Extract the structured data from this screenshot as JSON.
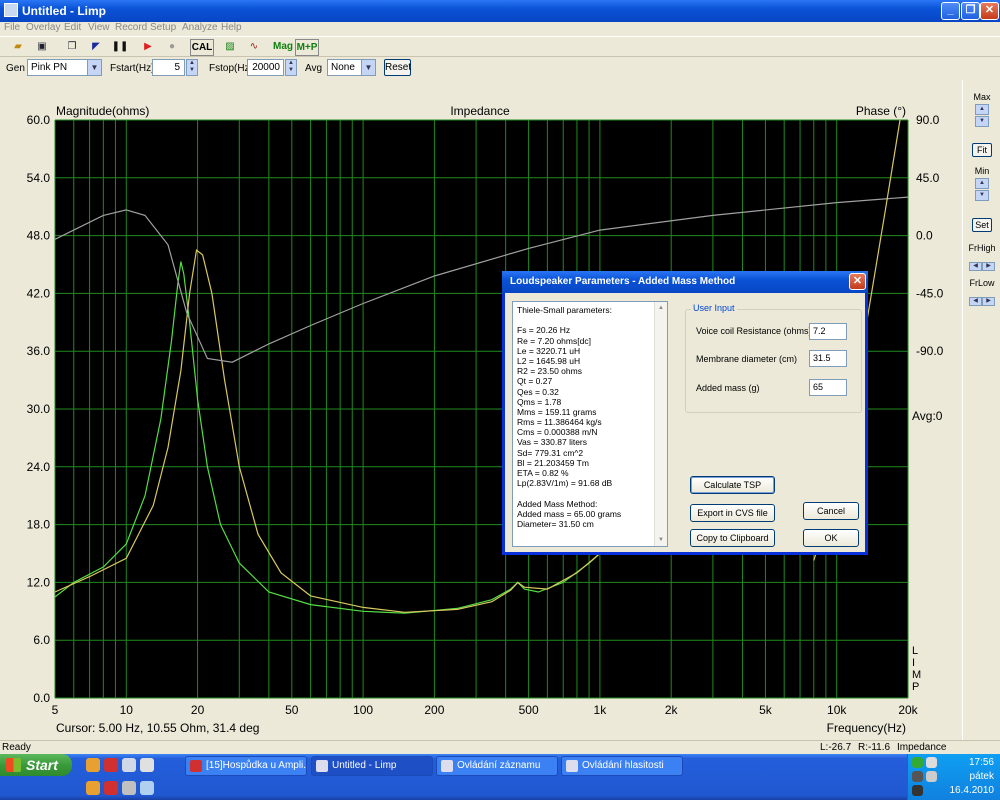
{
  "window": {
    "title": "Untitled - Limp"
  },
  "menu": [
    "File",
    "Overlay",
    "Edit",
    "View",
    "Record",
    "Setup",
    "Analyze",
    "Help"
  ],
  "toolbar": {
    "cal": "CAL",
    "mag": "Mag",
    "mp": "M+P"
  },
  "gen": {
    "gen_label": "Gen",
    "gen_value": "Pink PN",
    "fstart_label": "Fstart(Hz)",
    "fstart_value": "5",
    "fstop_label": "Fstop(Hz)",
    "fstop_value": "20000",
    "avg_label": "Avg",
    "avg_value": "None",
    "reset": "Reset"
  },
  "side": {
    "max": "Max",
    "fit": "Fit",
    "min": "Min",
    "set": "Set",
    "frhigh": "FrHigh",
    "frlow": "FrLow"
  },
  "chart": {
    "title": "Impedance",
    "left_label": "Magnitude(ohms)",
    "right_label": "Phase (°)",
    "x_label": "Frequency(Hz)",
    "avg_label": "Avg:0",
    "cursor": "Cursor: 5.00 Hz, 10.55 Ohm, 31.4 deg",
    "side_label": [
      "L",
      "I",
      "M",
      "P"
    ],
    "left_ticks": [
      "60.0",
      "54.0",
      "48.0",
      "42.0",
      "36.0",
      "30.0",
      "24.0",
      "18.0",
      "12.0",
      "6.0",
      "0.0"
    ],
    "right_ticks": [
      "90.0",
      "45.0",
      "0.0",
      "-45.0",
      "-90.0"
    ],
    "x_tick_labels": [
      "5",
      "10",
      "20",
      "50",
      "100",
      "200",
      "500",
      "1k",
      "2k",
      "5k",
      "10k",
      "20k"
    ],
    "colors": {
      "background": "#000000",
      "grid": "#1f8a1f",
      "magnitude_1": "#55dd44",
      "magnitude_2": "#d8c860",
      "phase": "#a0a0a0"
    }
  },
  "chart_data": {
    "type": "line",
    "title": "Impedance",
    "xlabel": "Frequency(Hz)",
    "ylabel": "Magnitude(ohms)",
    "y2label": "Phase (°)",
    "x_scale": "log",
    "xlim": [
      5,
      20000
    ],
    "ylim": [
      0,
      60
    ],
    "y2lim": [
      -225,
      90
    ],
    "grid": true,
    "series": [
      {
        "axis": "left",
        "points": [
          [
            5,
            10.5
          ],
          [
            6,
            12
          ],
          [
            8,
            13.6
          ],
          [
            10,
            16
          ],
          [
            12,
            21
          ],
          [
            14,
            29
          ],
          [
            15.5,
            37
          ],
          [
            16.5,
            43
          ],
          [
            17,
            45.3
          ],
          [
            17.5,
            44
          ],
          [
            18.5,
            39
          ],
          [
            20,
            31
          ],
          [
            22,
            24
          ],
          [
            25,
            18
          ],
          [
            30,
            14
          ],
          [
            40,
            11
          ],
          [
            60,
            9.7
          ],
          [
            100,
            9
          ],
          [
            150,
            8.8
          ],
          [
            250,
            9.3
          ],
          [
            350,
            10.2
          ],
          [
            420,
            11.3
          ],
          [
            450,
            12
          ],
          [
            480,
            11.3
          ],
          [
            550,
            11
          ],
          [
            700,
            12
          ],
          [
            900,
            14
          ],
          [
            1000,
            15
          ]
        ]
      },
      {
        "axis": "left",
        "points": [
          [
            5,
            11
          ],
          [
            7,
            12.6
          ],
          [
            10,
            14.5
          ],
          [
            13,
            20
          ],
          [
            15,
            26
          ],
          [
            17,
            34
          ],
          [
            18.5,
            42
          ],
          [
            19.8,
            46.5
          ],
          [
            21,
            46
          ],
          [
            23,
            42
          ],
          [
            26,
            33
          ],
          [
            30,
            24
          ],
          [
            36,
            17
          ],
          [
            45,
            13
          ],
          [
            60,
            10.6
          ],
          [
            100,
            9.4
          ],
          [
            150,
            8.9
          ],
          [
            250,
            9.2
          ],
          [
            350,
            10
          ],
          [
            420,
            11.2
          ],
          [
            450,
            12
          ],
          [
            480,
            11.5
          ],
          [
            600,
            11.3
          ],
          [
            800,
            13
          ],
          [
            1000,
            15
          ]
        ]
      },
      {
        "axis": "right",
        "points": [
          [
            5,
            25
          ],
          [
            8,
            38
          ],
          [
            10,
            41
          ],
          [
            12,
            38
          ],
          [
            15,
            22
          ],
          [
            18,
            -15
          ],
          [
            22,
            -40
          ],
          [
            28,
            -42
          ],
          [
            40,
            -32
          ],
          [
            60,
            -22
          ],
          [
            100,
            -10
          ],
          [
            200,
            5
          ],
          [
            500,
            20
          ],
          [
            1000,
            30
          ],
          [
            3000,
            38
          ],
          [
            10000,
            45
          ],
          [
            20000,
            48
          ]
        ]
      },
      {
        "axis": "right",
        "points": [
          [
            8000,
            -150
          ],
          [
            10000,
            -110
          ],
          [
            13000,
            -30
          ],
          [
            16000,
            40
          ],
          [
            18500,
            90
          ]
        ]
      }
    ]
  },
  "status": {
    "ready": "Ready",
    "l": "L:-26.7",
    "r": "R:-11.6",
    "mode": "Impedance Measurement"
  },
  "dialog": {
    "title": "Loudspeaker Parameters - Added Mass Method",
    "tsp_lines": [
      "Thiele-Small parameters:",
      "",
      "Fs  = 20.26 Hz",
      "Re  = 7.20 ohms[dc]",
      "Le  = 3220.71 uH",
      "L2  = 1645.98 uH",
      "R2  = 23.50 ohms",
      "Qt  = 0.27",
      "Qes = 0.32",
      "Qms = 1.78",
      "Mms = 159.11 grams",
      "Rms = 11.386464 kg/s",
      "Cms = 0.000388 m/N",
      "Vas = 330.87 liters",
      "Sd= 779.31 cm^2",
      "Bl  = 21.203459 Tm",
      "ETA = 0.82 %",
      "Lp(2.83V/1m) = 91.68 dB",
      "",
      "Added Mass Method:",
      "Added mass = 65.00 grams",
      "Diameter= 31.50 cm"
    ],
    "group_title": "User Input",
    "voice_coil_label": "Voice coil Resistance (ohms)",
    "voice_coil_value": "7.2",
    "membrane_label": "Membrane diameter (cm)",
    "membrane_value": "31.5",
    "mass_label": "Added mass (g)",
    "mass_value": "65",
    "calc": "Calculate TSP",
    "export": "Export in CVS file",
    "cancel": "Cancel",
    "copy": "Copy to Clipboard",
    "ok": "OK"
  },
  "taskbar": {
    "start": "Start",
    "tasks": [
      "[15]Hospůdka u Ampli...",
      "Untitled - Limp",
      "Ovládání záznamu",
      "Ovládání hlasitosti"
    ],
    "time": "17:56",
    "day": "pátek",
    "date": "16.4.2010"
  }
}
